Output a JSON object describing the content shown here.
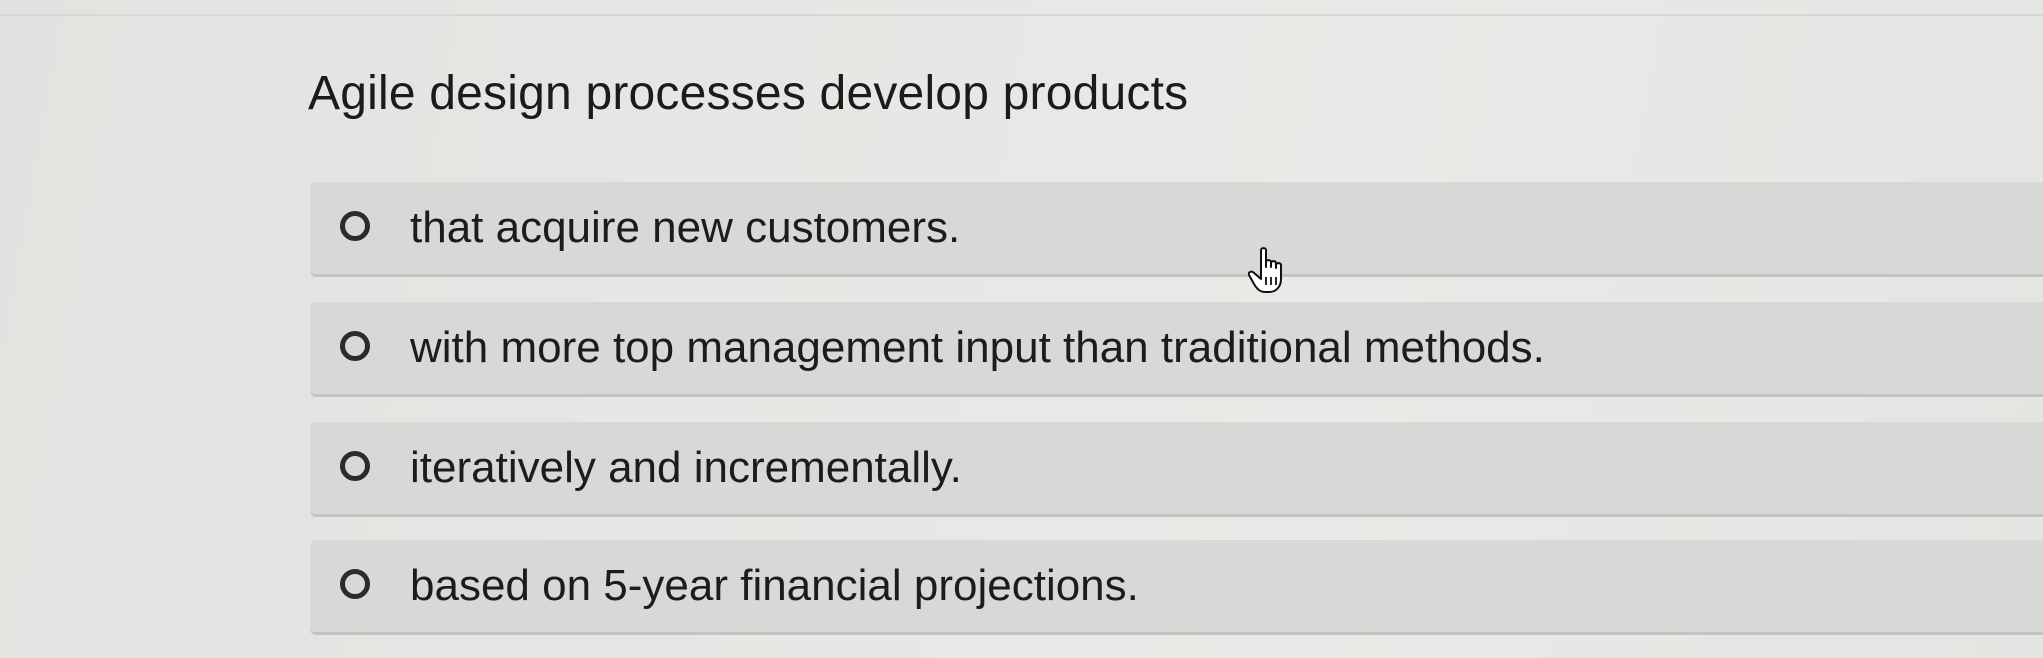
{
  "question": {
    "text": "Agile design processes develop products"
  },
  "options": [
    {
      "label": "that acquire new customers.",
      "selected": false
    },
    {
      "label": "with more top management input than traditional methods.",
      "selected": false
    },
    {
      "label": "iteratively and incrementally.",
      "selected": false
    },
    {
      "label": "based on 5-year financial projections.",
      "selected": false
    }
  ],
  "cursor": {
    "icon": "hand-pointer-icon"
  },
  "colors": {
    "background": "#e6e7e4",
    "option_background": "#d8d9d6",
    "option_border": "#c3c4c1",
    "text": "#1c1c1c"
  }
}
